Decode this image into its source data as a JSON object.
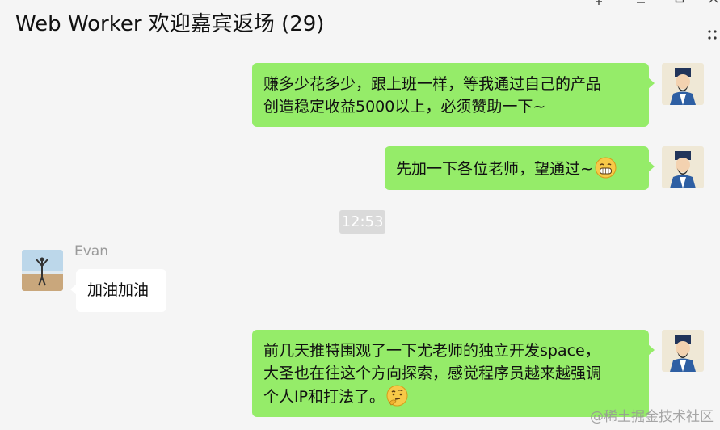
{
  "window": {
    "title": "Web Worker 欢迎嘉宾返场 (29)",
    "controls": [
      "pin-icon",
      "minimize-icon",
      "maximize-icon",
      "close-icon"
    ],
    "more_label": "⋮"
  },
  "messages": [
    {
      "side": "right",
      "lines": [
        "赚多少花多少，跟上班一样，等我通过自己的产品",
        "创造稳定收益5000以上，必须赞助一下~"
      ]
    },
    {
      "side": "right",
      "text": "先加一下各位老师，望通过~",
      "emoji": "grin-emoji"
    },
    {
      "type": "time",
      "text": "12:53"
    },
    {
      "side": "left",
      "sender": "Evan",
      "text": "加油加油"
    },
    {
      "side": "right",
      "lines": [
        "前几天推特围观了一下尤老师的独立开发space，",
        "大圣也在往这个方向探索，感觉程序员越来越强调",
        "个人IP和打法了。"
      ],
      "emoji": "thinking-emoji"
    }
  ],
  "watermark": "@稀土掘金技术社区",
  "colors": {
    "my_bubble": "#95ec69",
    "other_bubble": "#ffffff",
    "background": "#f5f5f5",
    "time_badge": "#dadada"
  }
}
